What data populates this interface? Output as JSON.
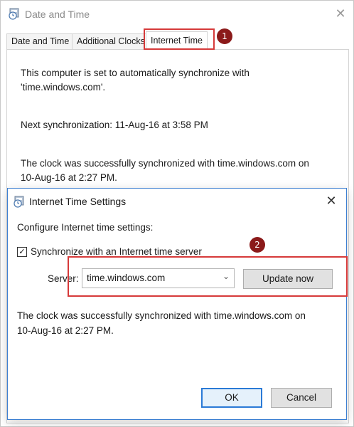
{
  "outer_window": {
    "title": "Date and Time",
    "close_glyph": "✕",
    "icon": "date-time-icon",
    "tabs": [
      {
        "label": "Date and Time"
      },
      {
        "label": "Additional Clocks"
      },
      {
        "label": "Internet Time"
      }
    ],
    "panel": {
      "auto_sync_line1": "This computer is set to automatically synchronize with",
      "auto_sync_line2": "'time.windows.com'.",
      "next_sync": "Next synchronization: 11-Aug-16 at 3:58 PM",
      "last_sync_line1": "The clock was successfully synchronized with time.windows.com on",
      "last_sync_line2": "10-Aug-16 at 2:27 PM."
    }
  },
  "annotations": {
    "badge_1": "1",
    "badge_2": "2",
    "highlight_color": "#d63a3a",
    "badge_color": "#8b1a1a"
  },
  "inner_dialog": {
    "title": "Internet Time Settings",
    "close_glyph": "✕",
    "icon": "date-time-icon",
    "configure_label": "Configure Internet time settings:",
    "sync_checkbox": {
      "label": "Synchronize with an Internet time server",
      "checked": true,
      "check_glyph": "✓"
    },
    "server_label": "Server:",
    "server_value": "time.windows.com",
    "server_chevron": "⌄",
    "update_button": "Update now",
    "status_line1": "The clock was successfully synchronized with time.windows.com on",
    "status_line2": "10-Aug-16 at 2:27 PM.",
    "ok_button": "OK",
    "cancel_button": "Cancel",
    "accent_color": "#2a7ad6"
  }
}
